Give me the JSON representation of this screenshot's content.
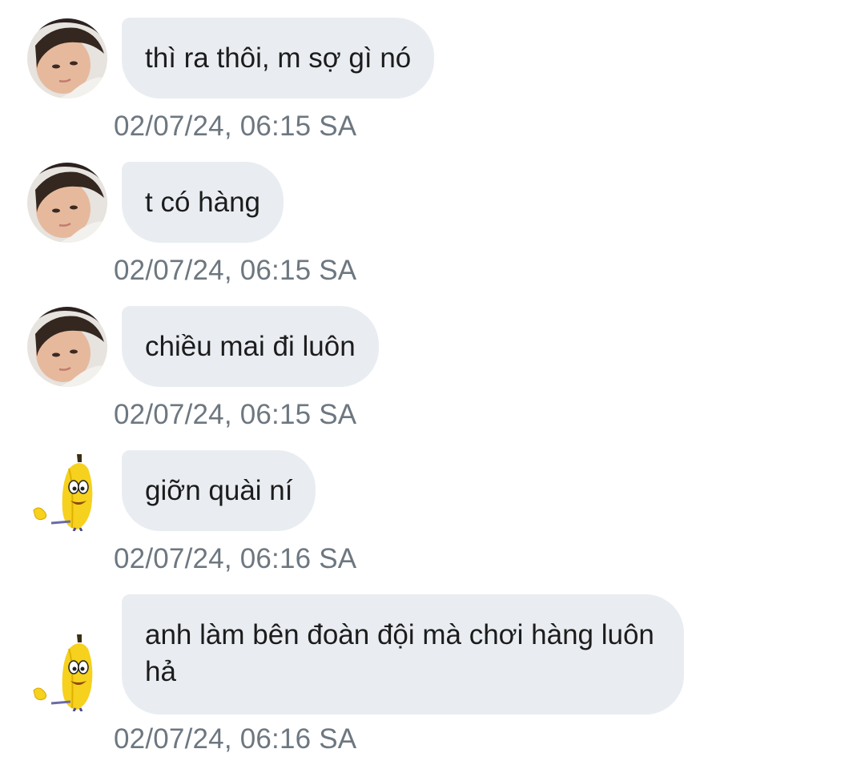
{
  "conversation": {
    "messages": [
      {
        "sender": "photo",
        "text": "thì ra thôi, m sợ gì nó",
        "timestamp": "02/07/24, 06:15 SA"
      },
      {
        "sender": "photo",
        "text": "t có hàng",
        "timestamp": "02/07/24, 06:15 SA"
      },
      {
        "sender": "photo",
        "text": "chiều mai đi luôn",
        "timestamp": "02/07/24, 06:15 SA"
      },
      {
        "sender": "banana",
        "text": "giỡn quài ní",
        "timestamp": "02/07/24, 06:16 SA"
      },
      {
        "sender": "banana",
        "text": "anh làm bên đoàn đội mà chơi hàng luôn hả",
        "timestamp": "02/07/24, 06:16 SA"
      }
    ]
  },
  "colors": {
    "bubble_background": "#e9edf2",
    "message_text": "#1c1c1c",
    "timestamp_text": "#6d7780",
    "page_background": "#ffffff"
  },
  "icons": {
    "photo_avatar": "person-photo-avatar",
    "banana_avatar": "banana-cartoon-avatar"
  }
}
